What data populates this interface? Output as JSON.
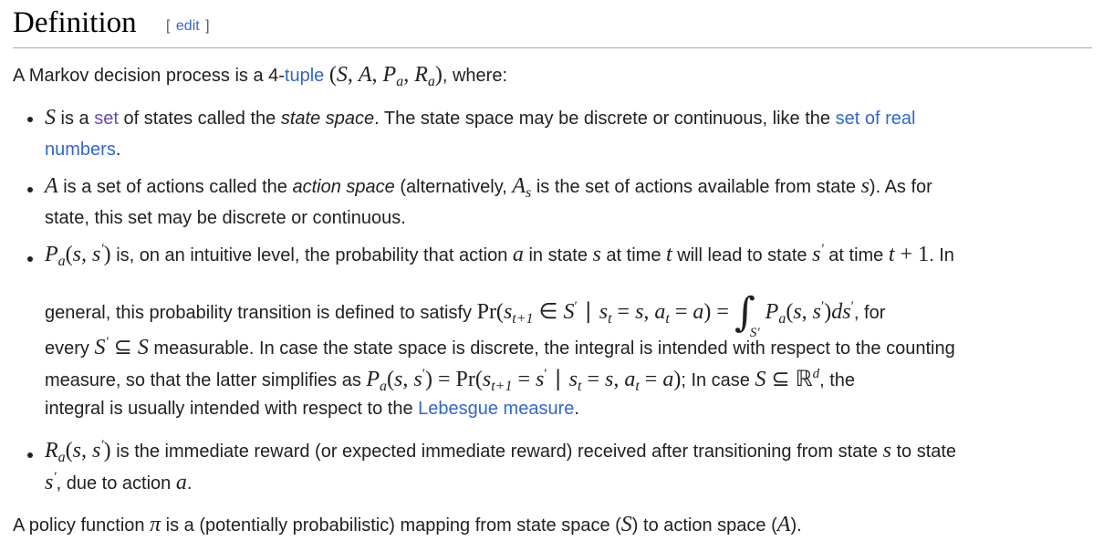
{
  "heading": {
    "title": "Definition",
    "edit_open": "[",
    "edit_label": "edit",
    "edit_close": "]"
  },
  "intro": {
    "text_before": "A Markov decision process is a 4-",
    "link_tuple": "tuple",
    "text_after": ", where:"
  },
  "items": [
    {
      "pre": " is a ",
      "link_set": "set",
      "mid": " of states called the ",
      "em_state_space": "state space",
      "post": ". The state space may be discrete or continuous, like the ",
      "link_real_1": "set of real",
      "link_real_2": "numbers",
      "end": "."
    },
    {
      "pre": " is a set of actions called the ",
      "em_action_space": "action space",
      "mid": " (alternatively, ",
      "post": " is the set of actions available from state ",
      "post2": "). As for",
      "line2": "state, this set may be discrete or continuous."
    },
    {
      "l1a": " is, on an intuitive level, the probability that action ",
      "l1b": " in state ",
      "l1c": " at time ",
      "l1d": " will lead to state ",
      "l1e": " at time ",
      "l1f": ". In",
      "l2a": "general, this probability transition is defined to satisfy ",
      "l2b": ", for",
      "l3a": "every ",
      "l3b": " measurable. In case the state space is discrete, the integral is intended with respect to the counting",
      "l4a": "measure, so that the latter simplifies as ",
      "l4b": "; In case ",
      "l4c": ", the",
      "l5a": "integral is usually intended with respect to the ",
      "link_lebesgue": "Lebesgue measure",
      "l5b": "."
    },
    {
      "l1a": " is the immediate reward (or expected immediate reward) received after transitioning from state ",
      "l1b": " to state",
      "l2a": ", due to action ",
      "l2b": "."
    }
  ],
  "policy": {
    "a": "A policy function ",
    "b": " is a (potentially probabilistic) mapping from state space (",
    "c": ") to action space (",
    "d": ")."
  }
}
